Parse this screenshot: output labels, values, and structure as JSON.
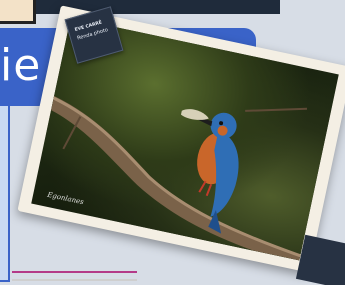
{
  "banner": {
    "text": "ie"
  },
  "caption_card": {
    "title": "EVE CARRÉ",
    "subtitle": "Renda photo"
  },
  "photo": {
    "signature": "Egonlanes"
  },
  "colors": {
    "banner": "#3a63c8",
    "panel": "#c9daf3",
    "accent_line": "#b43a88",
    "caption_bg": "#273243"
  }
}
